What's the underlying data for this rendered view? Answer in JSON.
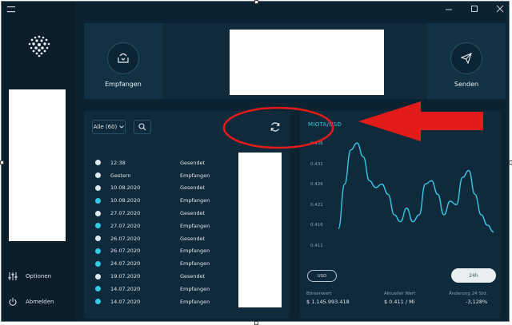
{
  "window": {
    "menu_icon": "hamburger-menu-icon",
    "controls": [
      "minimize-icon",
      "maximize-icon",
      "close-icon"
    ]
  },
  "sidebar": {
    "logo": "iota-logo",
    "options_label": "Optionen",
    "logout_label": "Abmelden"
  },
  "top": {
    "receive_label": "Empfangen",
    "send_label": "Senden"
  },
  "transactions": {
    "filter_label": "Alle (60)",
    "rows": [
      {
        "date": "12:38",
        "type": "Gesendet",
        "dot": "#dfe8ed"
      },
      {
        "date": "Gestern",
        "type": "Empfangen",
        "dot": "#dfe8ed"
      },
      {
        "date": "10.08.2020",
        "type": "Gesendet",
        "dot": "#dfe8ed"
      },
      {
        "date": "10.08.2020",
        "type": "Empfangen",
        "dot": "#34c8e6"
      },
      {
        "date": "27.07.2020",
        "type": "Gesendet",
        "dot": "#dfe8ed"
      },
      {
        "date": "27.07.2020",
        "type": "Empfangen",
        "dot": "#34c8e6"
      },
      {
        "date": "26.07.2020",
        "type": "Gesendet",
        "dot": "#dfe8ed"
      },
      {
        "date": "26.07.2020",
        "type": "Empfangen",
        "dot": "#34c8e6"
      },
      {
        "date": "24.07.2020",
        "type": "Empfangen",
        "dot": "#34c8e6"
      },
      {
        "date": "19.07.2020",
        "type": "Gesendet",
        "dot": "#dfe8ed"
      },
      {
        "date": "14.07.2020",
        "type": "Empfangen",
        "dot": "#34c8e6"
      },
      {
        "date": "14.07.2020",
        "type": "Empfangen",
        "dot": "#34c8e6"
      }
    ]
  },
  "chart": {
    "title": "MIOTA/USD",
    "currency_button": "USD",
    "range_button": "24h",
    "stats": [
      {
        "label": "Börsenwert",
        "value": "$ 1.145.993.418"
      },
      {
        "label": "Aktueller Wert",
        "value": "$ 0.411 / Mi"
      },
      {
        "label": "Änderung 24 Std.",
        "value": "-3,128%"
      }
    ]
  },
  "chart_data": {
    "type": "line",
    "title": "MIOTA/USD",
    "yticks": [
      "0.436",
      "0.431",
      "0.426",
      "0.421",
      "0.416",
      "0.411"
    ],
    "ylim": [
      0.406,
      0.441
    ],
    "grid": false,
    "series": [
      {
        "values": [
          0.412,
          0.425,
          0.435,
          0.437,
          0.433,
          0.426,
          0.424,
          0.425,
          0.422,
          0.416,
          0.414,
          0.418,
          0.414,
          0.416,
          0.425,
          0.426,
          0.422,
          0.416,
          0.42,
          0.419,
          0.427,
          0.429,
          0.422,
          0.416,
          0.413,
          0.411
        ],
        "color": "#34c8e6"
      }
    ]
  },
  "colors": {
    "accent": "#34c8e6",
    "panel": "#0f2a3a",
    "background": "#0b2230",
    "annotation": "#e41b1b"
  }
}
